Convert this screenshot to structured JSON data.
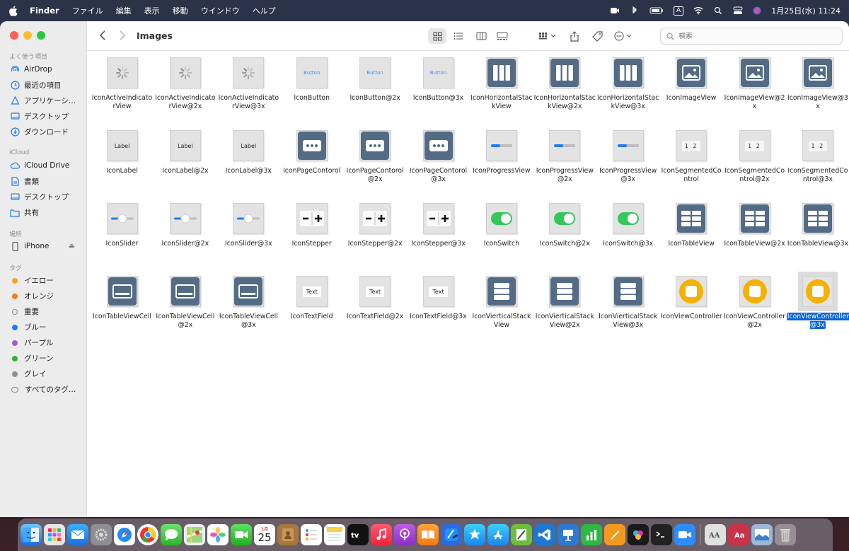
{
  "menubar": {
    "app_name": "Finder",
    "menus": [
      "ファイル",
      "編集",
      "表示",
      "移動",
      "ウインドウ",
      "ヘルプ"
    ],
    "input_mode": "A",
    "datetime": "1月25日(水)  11:24"
  },
  "window": {
    "title": "Images",
    "search_placeholder": "検索"
  },
  "sidebar": {
    "sections": {
      "favorites": "よく使う項目",
      "icloud": "iCloud",
      "locations": "場所",
      "tags": "タグ"
    },
    "favorites": [
      "AirDrop",
      "最近の項目",
      "アプリケーシ…",
      "デスクトップ",
      "ダウンロード"
    ],
    "icloud": [
      "iCloud Drive",
      "書類",
      "デスクトップ",
      "共有"
    ],
    "locations": [
      "iPhone"
    ],
    "tags": [
      {
        "label": "イエロー",
        "color": "#f5a623"
      },
      {
        "label": "オレンジ",
        "color": "#f57c1f"
      },
      {
        "label": "重要",
        "color": ""
      },
      {
        "label": "ブルー",
        "color": "#1f7bf6"
      },
      {
        "label": "パープル",
        "color": "#a05cd6"
      },
      {
        "label": "グリーン",
        "color": "#34b233"
      },
      {
        "label": "グレイ",
        "color": "#8e8e8e"
      },
      {
        "label": "すべてのタグ…",
        "color": ""
      }
    ]
  },
  "files": [
    {
      "label": "IconActiveIndicatorView",
      "type": "spinner"
    },
    {
      "label": "IconActiveIndicatorView@2x",
      "type": "spinner"
    },
    {
      "label": "IconActiveIndicatorView@3x",
      "type": "spinner"
    },
    {
      "label": "IconButton",
      "type": "button",
      "text": "Button"
    },
    {
      "label": "IconButton@2x",
      "type": "button",
      "text": "Button"
    },
    {
      "label": "IconButton@3x",
      "type": "button",
      "text": "Button"
    },
    {
      "label": "IconHorizontalStackView",
      "type": "hstack"
    },
    {
      "label": "IconHorizontalStackView@2x",
      "type": "hstack"
    },
    {
      "label": "IconHorizontalStackView@3x",
      "type": "hstack"
    },
    {
      "label": "IconImageView",
      "type": "image"
    },
    {
      "label": "IconImageView@2x",
      "type": "image"
    },
    {
      "label": "IconImageView@3x",
      "type": "image"
    },
    {
      "label": "IconLabel",
      "type": "label",
      "text": "Label"
    },
    {
      "label": "IconLabel@2x",
      "type": "label",
      "text": "Label"
    },
    {
      "label": "IconLabel@3x",
      "type": "label",
      "text": "Label"
    },
    {
      "label": "IconPageContorol",
      "type": "dots"
    },
    {
      "label": "IconPageContorol@2x",
      "type": "dots"
    },
    {
      "label": "IconPageContorol@3x",
      "type": "dots"
    },
    {
      "label": "IconProgressView",
      "type": "progress"
    },
    {
      "label": "IconProgressView@2x",
      "type": "progress"
    },
    {
      "label": "IconProgressView@3x",
      "type": "progress"
    },
    {
      "label": "IconSegmentedControl",
      "type": "segmented",
      "text": "1 2"
    },
    {
      "label": "IconSegmentedControl@2x",
      "type": "segmented",
      "text": "1 2"
    },
    {
      "label": "IconSegmentedControl@3x",
      "type": "segmented",
      "text": "1 2"
    },
    {
      "label": "IconSlider",
      "type": "slider"
    },
    {
      "label": "IconSlider@2x",
      "type": "slider"
    },
    {
      "label": "IconSlider@3x",
      "type": "slider"
    },
    {
      "label": "IconStepper",
      "type": "stepper"
    },
    {
      "label": "IconStepper@2x",
      "type": "stepper"
    },
    {
      "label": "IconStepper@3x",
      "type": "stepper"
    },
    {
      "label": "IconSwitch",
      "type": "switch"
    },
    {
      "label": "IconSwitch@2x",
      "type": "switch"
    },
    {
      "label": "IconSwitch@3x",
      "type": "switch"
    },
    {
      "label": "IconTableView",
      "type": "table"
    },
    {
      "label": "IconTableView@2x",
      "type": "table"
    },
    {
      "label": "IconTableView@3x",
      "type": "table"
    },
    {
      "label": "IconTableViewCell",
      "type": "cell"
    },
    {
      "label": "IconTableViewCell@2x",
      "type": "cell"
    },
    {
      "label": "IconTableViewCell@3x",
      "type": "cell"
    },
    {
      "label": "IconTextField",
      "type": "textfield",
      "text": "Text"
    },
    {
      "label": "IconTextField@2x",
      "type": "textfield",
      "text": "Text"
    },
    {
      "label": "IconTextField@3x",
      "type": "textfield",
      "text": "Text"
    },
    {
      "label": "IconVierticalStackView",
      "type": "vstack"
    },
    {
      "label": "IconVierticalStackView@2x",
      "type": "vstack"
    },
    {
      "label": "IconVierticalStackView@3x",
      "type": "vstack"
    },
    {
      "label": "IconViewController",
      "type": "viewcontroller"
    },
    {
      "label": "IconViewController@2x",
      "type": "viewcontroller"
    },
    {
      "label": "IconViewController@3x",
      "type": "viewcontroller",
      "selected": true
    }
  ],
  "colors": {
    "accent": "#0a64d8",
    "icon_dark": "#536b85",
    "switch_green": "#34c759",
    "vc_orange": "#f5b000"
  }
}
